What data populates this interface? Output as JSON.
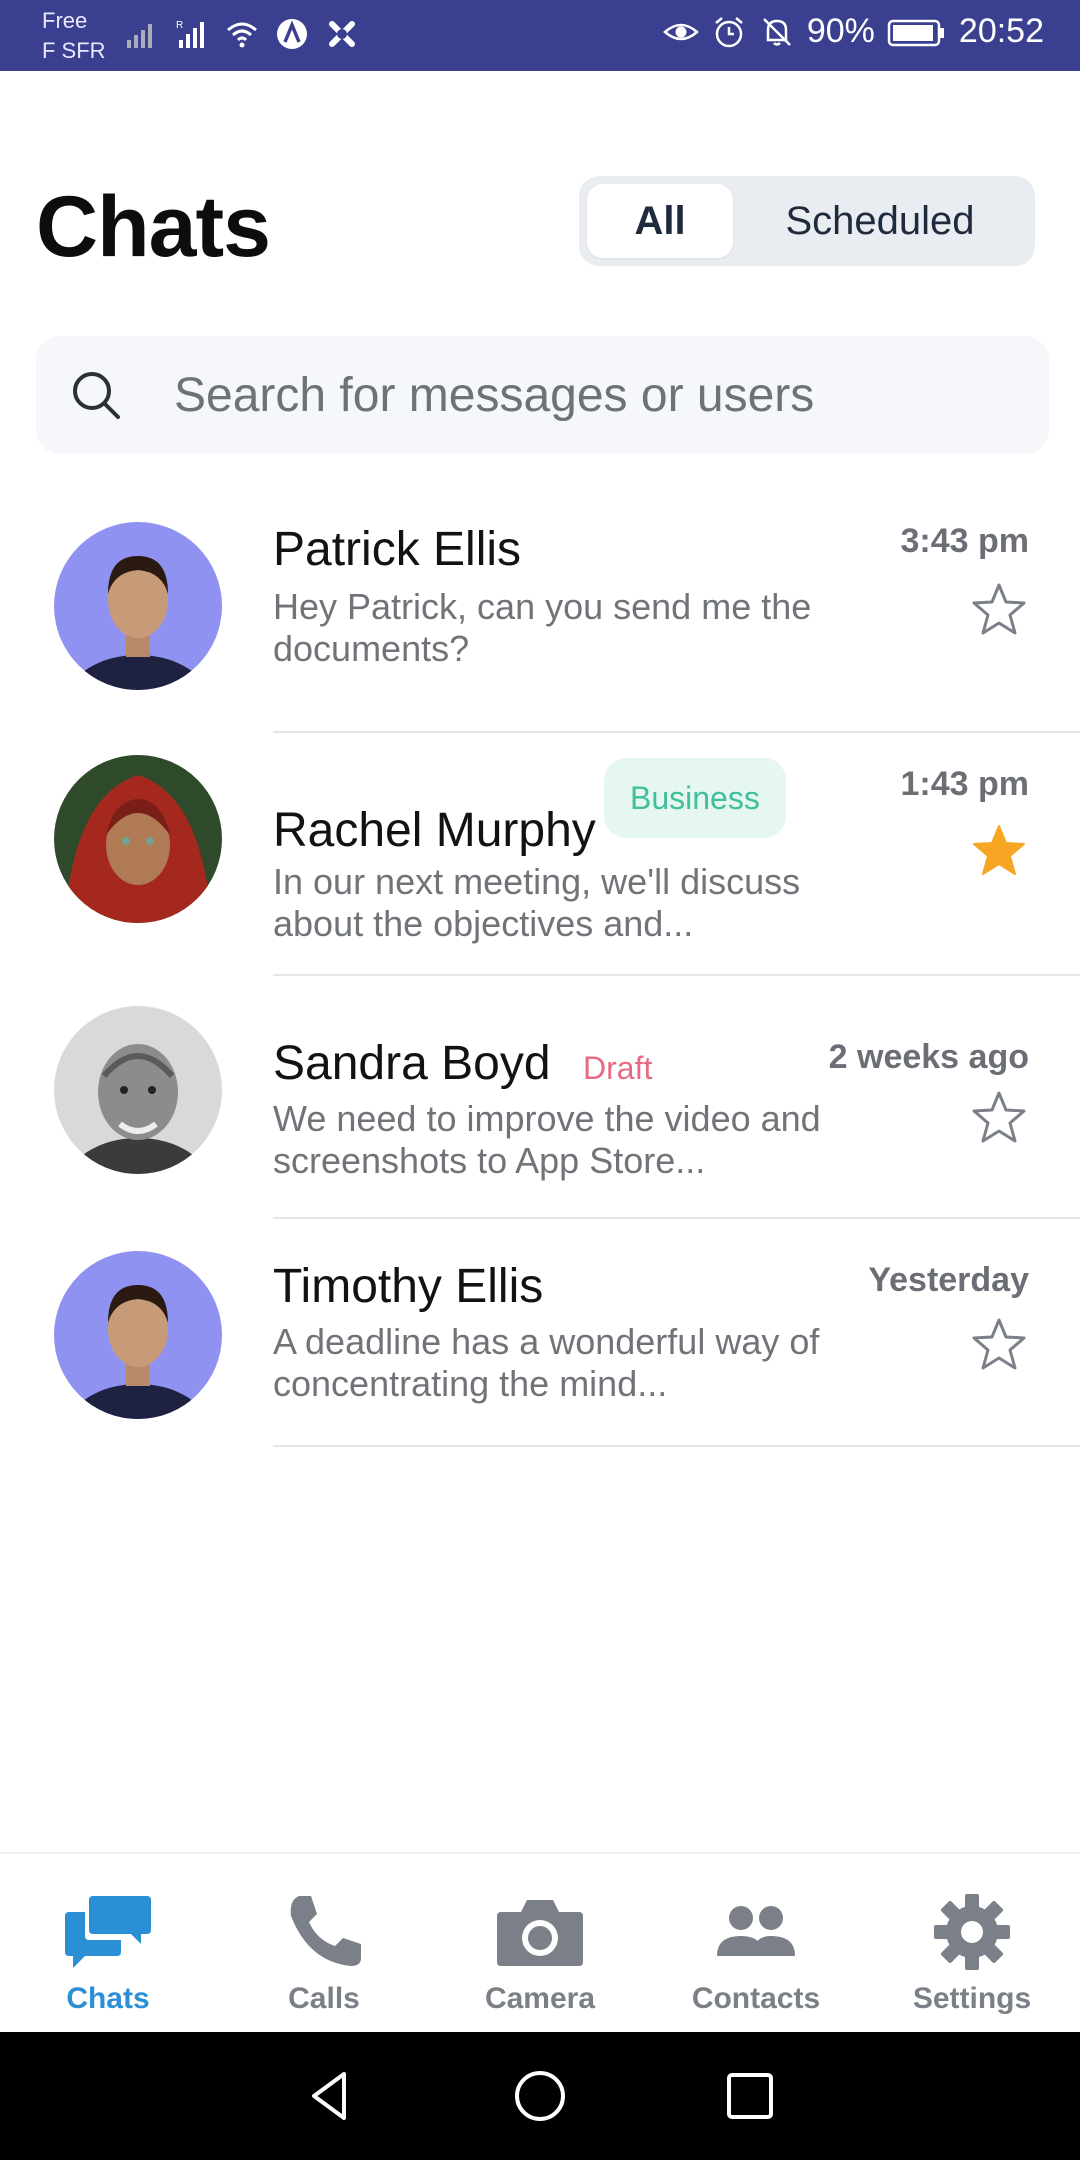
{
  "status_bar": {
    "carrier_line1": "Free",
    "carrier_line2": "F SFR",
    "battery": "90%",
    "time": "20:52",
    "icons": [
      "signal-icon",
      "signal-roaming-icon",
      "wifi-icon",
      "vpn-icon",
      "app-notification-icon",
      "eye-icon",
      "alarm-icon",
      "silent-bell-icon",
      "battery-icon"
    ]
  },
  "header": {
    "title": "Chats",
    "tabs": [
      {
        "label": "All",
        "selected": true
      },
      {
        "label": "Scheduled",
        "selected": false
      }
    ]
  },
  "search": {
    "placeholder": "Search for messages or users"
  },
  "chats": [
    {
      "name": "Patrick Ellis",
      "message": "Hey Patrick, can you send me the documents?",
      "time": "3:43 pm",
      "starred": false,
      "tag": ""
    },
    {
      "name": "Rachel Murphy",
      "message": "In our next meeting, we'll discuss about the objectives and...",
      "time": "1:43 pm",
      "starred": true,
      "tag": "Business"
    },
    {
      "name": "Sandra Boyd",
      "message": "We need to improve the video and screenshots to App Store...",
      "time": "2 weeks ago",
      "starred": false,
      "tag": "Draft"
    },
    {
      "name": "Timothy Ellis",
      "message": "A deadline has a wonderful way of concentrating the mind...",
      "time": "Yesterday",
      "starred": false,
      "tag": ""
    }
  ],
  "bottom_nav": [
    {
      "label": "Chats",
      "icon": "chat-bubbles-icon",
      "active": true
    },
    {
      "label": "Calls",
      "icon": "phone-icon",
      "active": false
    },
    {
      "label": "Camera",
      "icon": "camera-icon",
      "active": false
    },
    {
      "label": "Contacts",
      "icon": "contacts-icon",
      "active": false
    },
    {
      "label": "Settings",
      "icon": "gear-icon",
      "active": false
    }
  ],
  "colors": {
    "status_bar": "#3a3f8f",
    "accent": "#2b8fd6",
    "star_active": "#f6a623",
    "badge_business_text": "#3fbf9a",
    "badge_business_bg": "#e6f7f2",
    "badge_draft": "#e76a85"
  }
}
